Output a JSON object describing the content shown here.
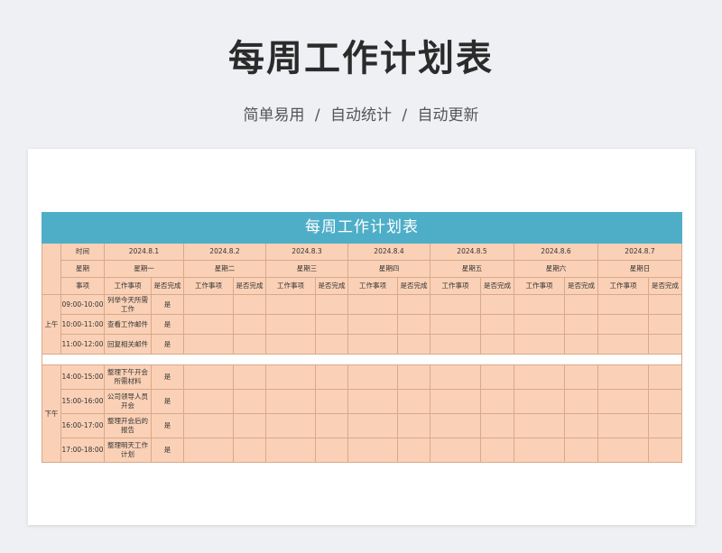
{
  "page": {
    "title": "每周工作计划表",
    "subtitle": "简单易用 / 自动统计 / 自动更新"
  },
  "table": {
    "title": "每周工作计划表",
    "row_labels": {
      "time": "时间",
      "weekday": "星期",
      "item": "事项"
    },
    "col_headers": {
      "task": "工作事项",
      "done": "是否完成"
    },
    "days": [
      {
        "date": "2024.8.1",
        "weekday": "星期一"
      },
      {
        "date": "2024.8.2",
        "weekday": "星期二"
      },
      {
        "date": "2024.8.3",
        "weekday": "星期三"
      },
      {
        "date": "2024.8.4",
        "weekday": "星期四"
      },
      {
        "date": "2024.8.5",
        "weekday": "星期五"
      },
      {
        "date": "2024.8.6",
        "weekday": "星期六"
      },
      {
        "date": "2024.8.7",
        "weekday": "星期日"
      }
    ],
    "morning": {
      "label": "上午",
      "rows": [
        {
          "time": "09:00-10:00",
          "task": "列举今天所需工作",
          "done": "是"
        },
        {
          "time": "10:00-11:00",
          "task": "查看工作邮件",
          "done": "是"
        },
        {
          "time": "11:00-12:00",
          "task": "回复相关邮件",
          "done": "是"
        }
      ]
    },
    "afternoon": {
      "label": "下午",
      "rows": [
        {
          "time": "14:00-15:00",
          "task": "整理下午开会所需材料",
          "done": "是"
        },
        {
          "time": "15:00-16:00",
          "task": "公司领导人员开会",
          "done": "是"
        },
        {
          "time": "16:00-17:00",
          "task": "整理开会后的报告",
          "done": "是"
        },
        {
          "time": "17:00-18:00",
          "task": "整理明天工作计划",
          "done": "是"
        }
      ]
    }
  }
}
